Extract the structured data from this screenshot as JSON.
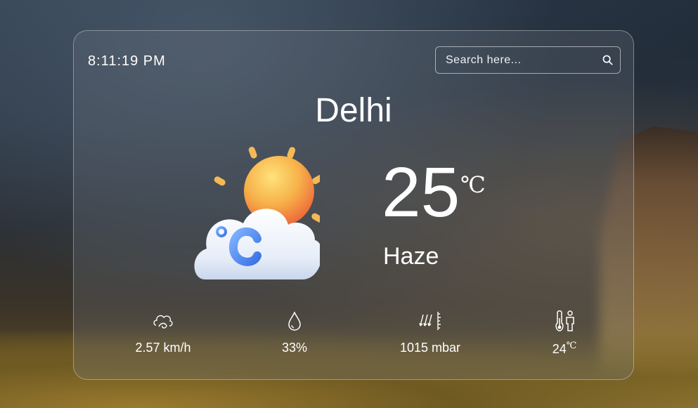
{
  "clock": "8:11:19 PM",
  "search": {
    "placeholder": "Search here..."
  },
  "city": "Delhi",
  "temperature": "25",
  "temperature_unit": "℃",
  "condition": "Haze",
  "stats": {
    "wind": {
      "value": "2.57 km/h",
      "icon": "wind-icon"
    },
    "humidity": {
      "value": "33%",
      "icon": "humidity-drop-icon"
    },
    "pressure": {
      "value": "1015 mbar",
      "icon": "pressure-icon"
    },
    "feels_like": {
      "value": "24",
      "unit": "℃",
      "icon": "feels-like-icon"
    }
  },
  "weather_icon": "sun-cloud-celsius-icon"
}
